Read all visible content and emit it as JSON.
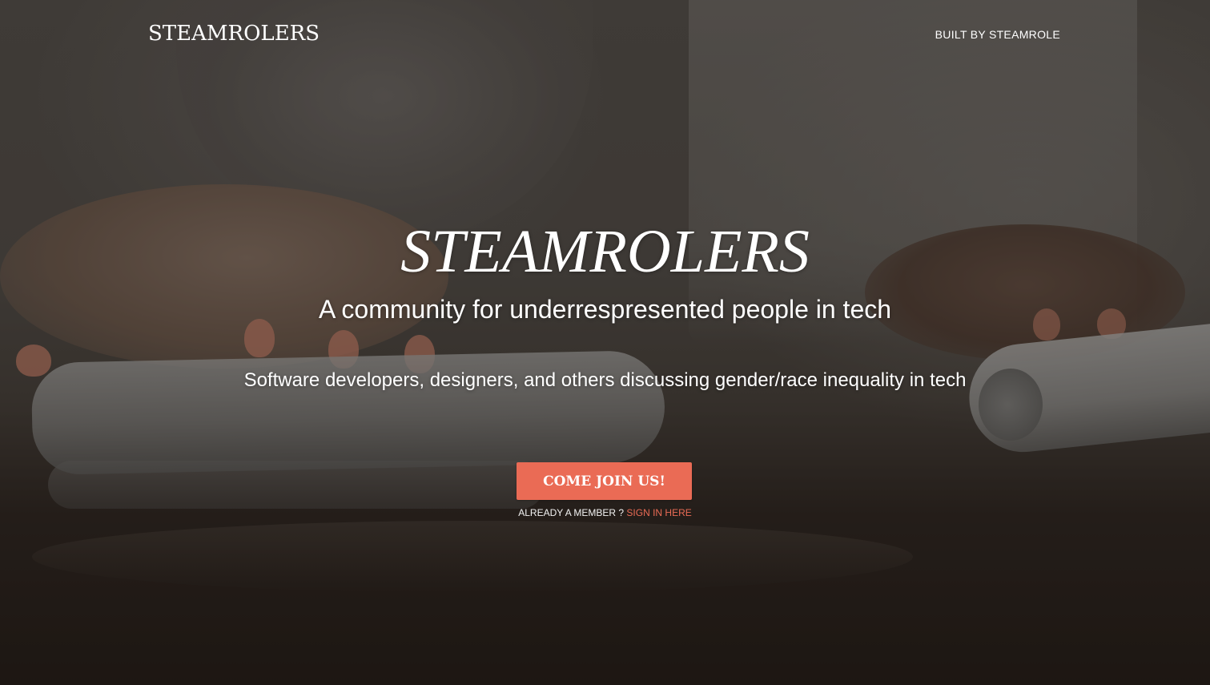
{
  "header": {
    "brand": "STEAMROLERS",
    "built_by_link": "BUILT BY STEAMROLE"
  },
  "hero": {
    "title": "STEAMROLERS",
    "tagline": "A community for underrespresented people in tech",
    "description": "Software developers, designers, and others discussing gender/race inequality in tech",
    "cta_button": "COME JOIN US!",
    "member_prompt": "ALREADY A MEMBER ?",
    "signin_link": "SIGN IN HERE"
  },
  "colors": {
    "accent": "#ea6b55",
    "text": "#ffffff",
    "overlay": "#141211"
  }
}
